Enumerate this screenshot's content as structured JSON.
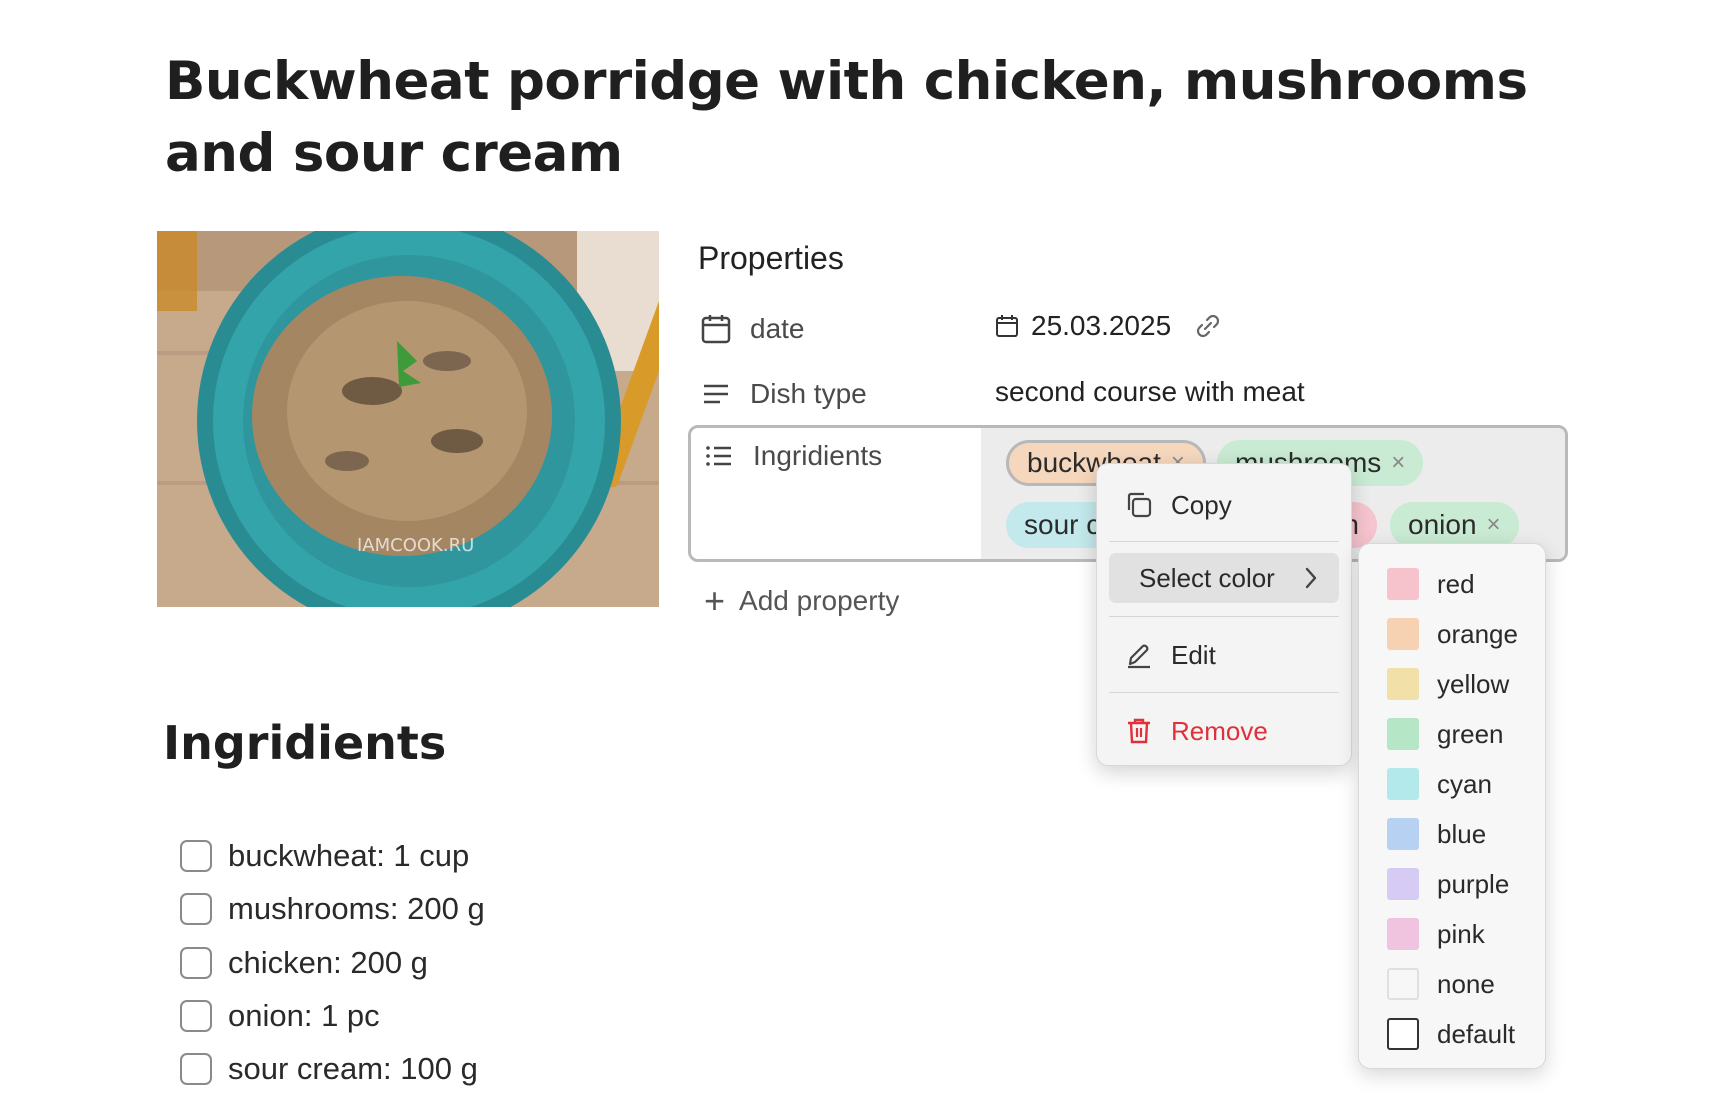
{
  "page": {
    "title": "Buckwheat porridge with chicken, mushrooms and sour cream"
  },
  "cover_image": {
    "watermark": "IAMCOOK.RU"
  },
  "properties": {
    "heading": "Properties",
    "date": {
      "name": "date",
      "icon": "calendar-icon",
      "value": "25.03.2025",
      "link_icon": "link-icon"
    },
    "dish_type": {
      "name": "Dish type",
      "icon": "text-lines-icon",
      "value": "second course with meat"
    },
    "ingredients": {
      "name": "Ingridients",
      "icon": "list-icon",
      "tags": [
        {
          "label": "buckwheat",
          "color": "#f5d7bd"
        },
        {
          "label": "mushrooms",
          "color": "#c9ead3"
        },
        {
          "label": "sour cream",
          "color": "#c3e9ec"
        },
        {
          "label": "chicken",
          "color": "#f6c4ce"
        },
        {
          "label": "onion",
          "color": "#c9ead3"
        }
      ],
      "remove_glyph": "×"
    },
    "add_property": "Add property"
  },
  "ingredients_section": {
    "title": "Ingridients",
    "items": [
      {
        "label": "buckwheat: 1 cup",
        "checked": false
      },
      {
        "label": "mushrooms: 200 g",
        "checked": false
      },
      {
        "label": "chicken: 200 g",
        "checked": false
      },
      {
        "label": "onion: 1 pc",
        "checked": false
      },
      {
        "label": "sour cream: 100 g",
        "checked": false
      }
    ]
  },
  "context_menu": {
    "copy": "Copy",
    "select_color": "Select color",
    "edit": "Edit",
    "remove": "Remove",
    "remove_color": "#e0313b"
  },
  "color_menu": {
    "options": [
      {
        "label": "red",
        "color": "#f6c2cb"
      },
      {
        "label": "orange",
        "color": "#f6d2b2"
      },
      {
        "label": "yellow",
        "color": "#f1e0a8"
      },
      {
        "label": "green",
        "color": "#b5e6c6"
      },
      {
        "label": "cyan",
        "color": "#b3e9eb"
      },
      {
        "label": "blue",
        "color": "#b6d1f2"
      },
      {
        "label": "purple",
        "color": "#d6cbf5"
      },
      {
        "label": "pink",
        "color": "#f0c3df"
      },
      {
        "label": "none",
        "color": "none"
      },
      {
        "label": "default",
        "color": "default"
      }
    ]
  }
}
